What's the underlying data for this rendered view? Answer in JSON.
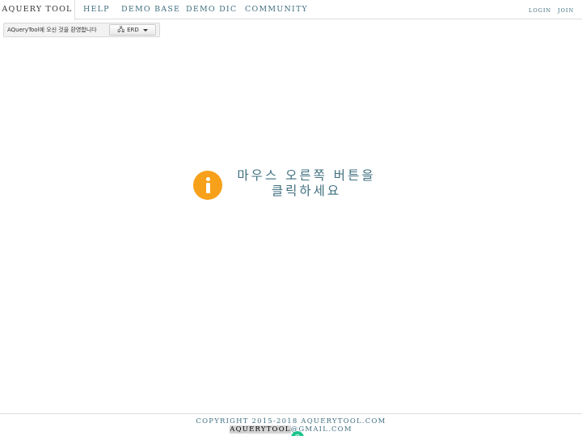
{
  "nav": {
    "tabs": [
      {
        "label": "AQUERY TOOL"
      },
      {
        "label": "HELP"
      },
      {
        "label": "DEMO BASE"
      },
      {
        "label": "DEMO DIC"
      },
      {
        "label": "COMMUNITY"
      }
    ],
    "login_label": "LOGIN",
    "join_label": "JOIN"
  },
  "toolbar": {
    "welcome_text": "AQueryTool에 오신 것을 환영합니다",
    "erd_label": "ERD",
    "erd_icon": "sitemap-icon"
  },
  "center": {
    "icon": "info-icon",
    "icon_color": "#f7a01a",
    "message_line1": "마우스 오른쪽 버튼을",
    "message_line2": "클릭하세요"
  },
  "footer": {
    "copyright": "COPYRIGHT 2015-2018 AQUERYTOOL.COM",
    "email_user": "AQUERYTOOL",
    "email_domain": "@GMAIL.COM",
    "badge_color": "#1ec48a"
  },
  "colors": {
    "accent_text": "#3f6f7f",
    "border": "#dddddd"
  }
}
